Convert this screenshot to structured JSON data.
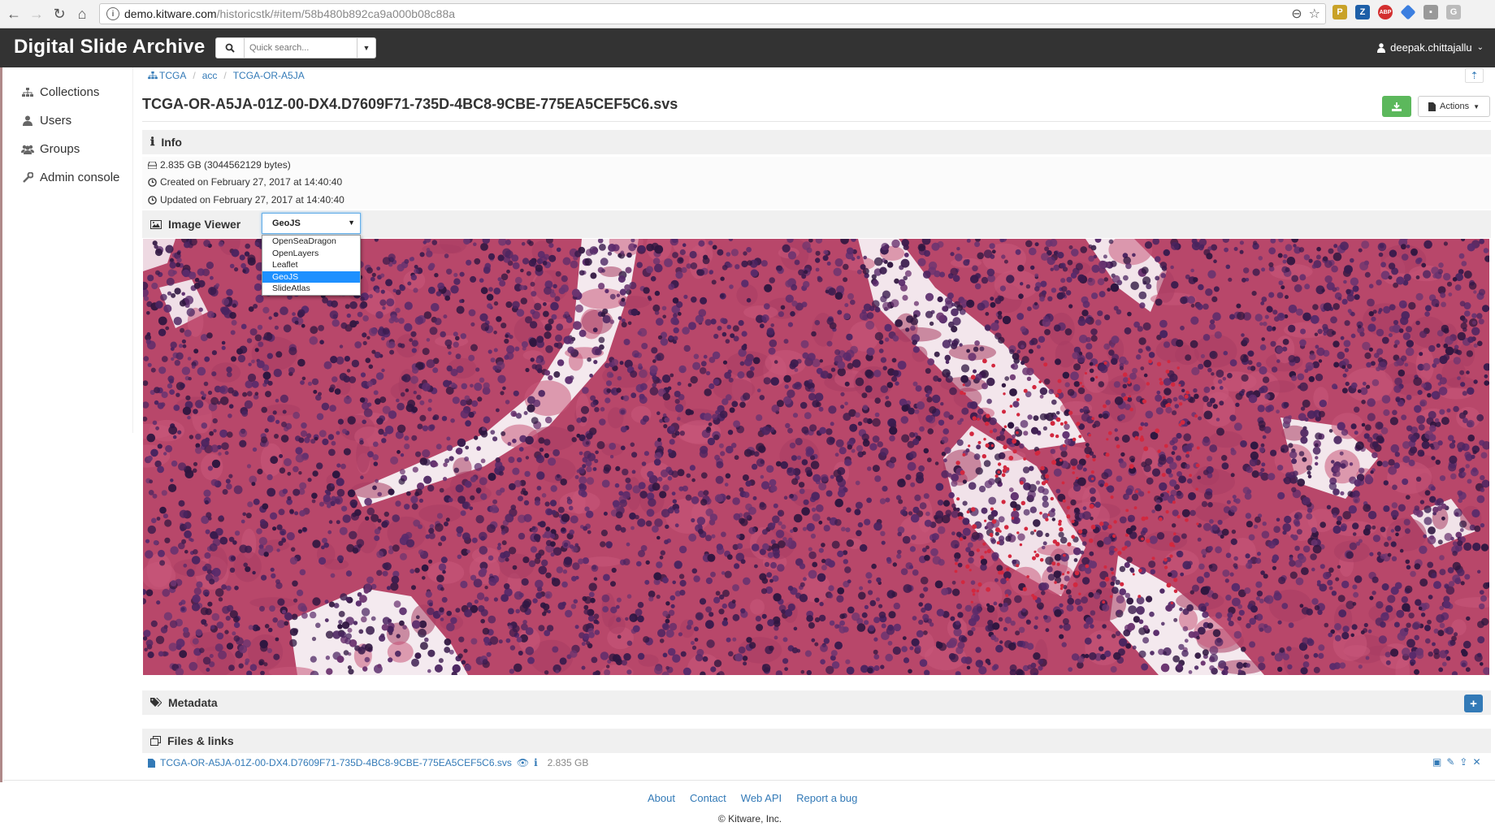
{
  "browser": {
    "url_host": "demo.kitware.com",
    "url_path": "/historicstk/#item/58b480b892ca9a000b08c88a"
  },
  "app": {
    "brand": "Digital Slide Archive",
    "search_placeholder": "Quick search...",
    "user": "deepak.chittajallu"
  },
  "sidebar": {
    "items": [
      {
        "label": "Collections",
        "icon": "sitemap-icon"
      },
      {
        "label": "Users",
        "icon": "user-icon"
      },
      {
        "label": "Groups",
        "icon": "users-icon"
      },
      {
        "label": "Admin console",
        "icon": "wrench-icon"
      }
    ]
  },
  "breadcrumb": {
    "items": [
      "TCGA",
      "acc",
      "TCGA-OR-A5JA"
    ]
  },
  "item": {
    "title": "TCGA-OR-A5JA-01Z-00-DX4.D7609F71-735D-4BC8-9CBE-775EA5CEF5C6.svs",
    "actions_label": "Actions"
  },
  "info": {
    "heading": "Info",
    "size": "2.835 GB (3044562129 bytes)",
    "created": "Created on February 27, 2017 at 14:40:40",
    "updated": "Updated on February 27, 2017 at 14:40:40"
  },
  "viewer": {
    "heading": "Image Viewer",
    "selected": "GeoJS",
    "options": [
      "OpenSeaDragon",
      "OpenLayers",
      "Leaflet",
      "GeoJS",
      "SlideAtlas"
    ]
  },
  "metadata": {
    "heading": "Metadata"
  },
  "files": {
    "heading": "Files & links",
    "file_name": "TCGA-OR-A5JA-01Z-00-DX4.D7609F71-735D-4BC8-9CBE-775EA5CEF5C6.svs",
    "file_size": "2.835 GB"
  },
  "footer": {
    "links": [
      "About",
      "Contact",
      "Web API",
      "Report a bug"
    ],
    "copyright": "© Kitware, Inc."
  },
  "colors": {
    "header_bg": "#333333",
    "link": "#337ab7",
    "success": "#5cb85c",
    "tissue_stroma": "#c04a6e",
    "tissue_nuclei": "#3d1f4f"
  }
}
